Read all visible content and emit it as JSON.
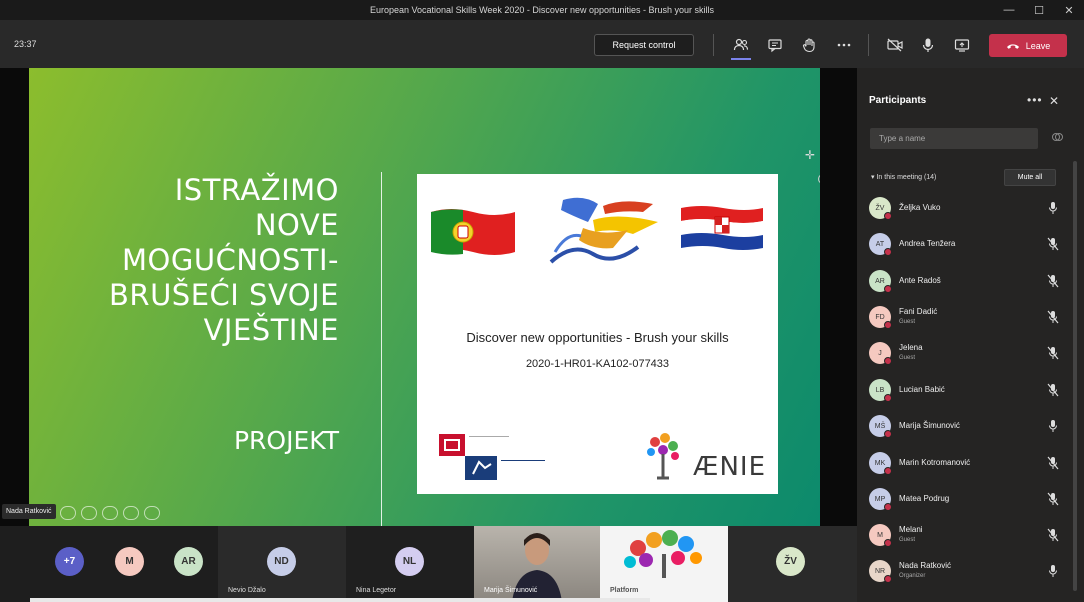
{
  "window": {
    "title": "European Vocational Skills Week 2020 - Discover new opportunities - Brush your skills",
    "controls": [
      "—",
      "☐",
      "✕"
    ]
  },
  "toolbar": {
    "timer": "23:37",
    "request_control": "Request control",
    "leave": "Leave"
  },
  "slide": {
    "title_lines": [
      "ISTRAŽIMO",
      "NOVE",
      "MOGUĆNOSTI-",
      "BRUŠEĆI SVOJE",
      "VJEŠTINE"
    ],
    "subtitle": "PROJEKT",
    "card_title": "Discover new opportunities - Brush your skills",
    "card_code": "2020-1-HR01-KA102-077433",
    "aenie_logo": "ÆNIE"
  },
  "presenter": {
    "name": "Nada Ratković"
  },
  "strip": {
    "overflow": "+7",
    "avatars": [
      {
        "initials": "M",
        "color": "#f5c9c0"
      },
      {
        "initials": "AR",
        "color": "#c9e3c7"
      }
    ],
    "tiles": [
      {
        "initials": "ND",
        "name": "Nevio Džalo",
        "color": "#c6cde8"
      },
      {
        "initials": "NL",
        "name": "Nina Legetor",
        "color": "#d4cdf0"
      },
      {
        "name": "Marija Šimunović"
      },
      {
        "name": "Platform"
      },
      {
        "initials": "ŽV",
        "color": "#d9e7c9"
      }
    ]
  },
  "panel": {
    "title": "Participants",
    "search_placeholder": "Type a name",
    "in_meeting": "In this meeting (14)",
    "mute_all": "Mute all",
    "participants": [
      {
        "initials": "ŽV",
        "name": "Željka Vuko",
        "sub": "",
        "color": "#d9e7c9",
        "mic": "on"
      },
      {
        "initials": "AT",
        "name": "Andrea Tenžera",
        "sub": "",
        "color": "#c6cde8",
        "mic": "off"
      },
      {
        "initials": "AR",
        "name": "Ante Radoš",
        "sub": "",
        "color": "#c9e3c7",
        "mic": "off"
      },
      {
        "initials": "FD",
        "name": "Fani Dadić",
        "sub": "Guest",
        "color": "#f5c9c0",
        "mic": "off"
      },
      {
        "initials": "J",
        "name": "Jelena",
        "sub": "Guest",
        "color": "#f5c9c0",
        "mic": "off"
      },
      {
        "initials": "LB",
        "name": "Lucian Babić",
        "sub": "",
        "color": "#c9e3c7",
        "mic": "off"
      },
      {
        "initials": "MŠ",
        "name": "Marija Šimunović",
        "sub": "",
        "color": "#c6cde8",
        "mic": "on"
      },
      {
        "initials": "MK",
        "name": "Marin Kotromanović",
        "sub": "",
        "color": "#c6cde8",
        "mic": "off"
      },
      {
        "initials": "MP",
        "name": "Matea Podrug",
        "sub": "",
        "color": "#c6cde8",
        "mic": "off"
      },
      {
        "initials": "M",
        "name": "Melani",
        "sub": "Guest",
        "color": "#f5c9c0",
        "mic": "off"
      },
      {
        "initials": "NR",
        "name": "Nada Ratković",
        "sub": "Organizer",
        "color": "#e8d6c9",
        "mic": "on"
      }
    ]
  }
}
